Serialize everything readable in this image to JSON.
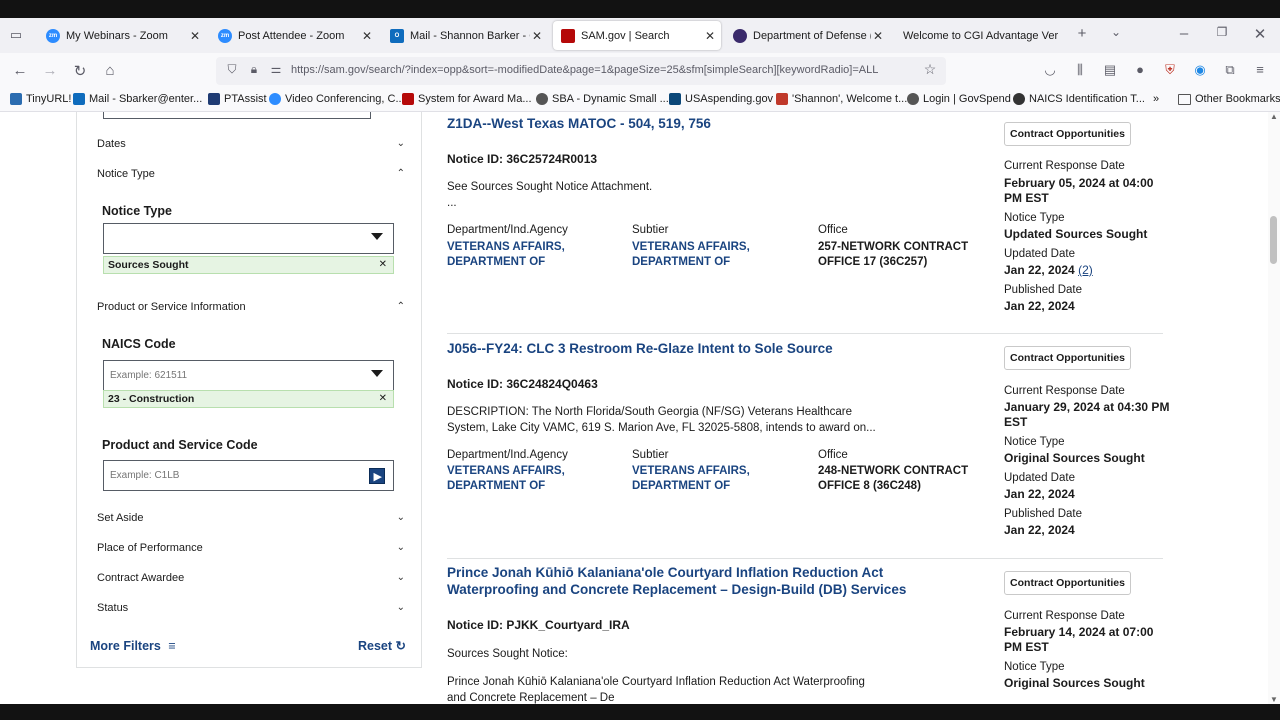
{
  "browser": {
    "tabs": [
      {
        "label": "My Webinars - Zoom",
        "icon": "zoom-icon",
        "color": "#2d8cff"
      },
      {
        "label": "Post Attendee - Zoom",
        "icon": "zoom-icon",
        "color": "#2d8cff"
      },
      {
        "label": "Mail - Shannon Barker - Out",
        "icon": "outlook-icon",
        "color": "#0f6cbd"
      },
      {
        "label": "SAM.gov | Search",
        "icon": "sam-icon",
        "color": "#b50909"
      },
      {
        "label": "Department of Defense (Do",
        "icon": "dod-icon",
        "color": "#3a2a6b"
      },
      {
        "label": "Welcome to CGI Advantage Ver",
        "icon": "",
        "color": ""
      }
    ],
    "url": "https://sam.gov/search/?index=opp&sort=-modifiedDate&page=1&pageSize=25&sfm[simpleSearch][keywordRadio]=ALL",
    "bookmarks": [
      {
        "label": "TinyURL!",
        "color": "#2b6cb0"
      },
      {
        "label": "Mail - Sbarker@enter...",
        "color": "#0f6cbd"
      },
      {
        "label": "PTAssist",
        "color": "#1f3b73"
      },
      {
        "label": "Video Conferencing, C...",
        "color": "#2d8cff"
      },
      {
        "label": "System for Award Ma...",
        "color": "#b50909"
      },
      {
        "label": "SBA - Dynamic Small ...",
        "color": "#555555"
      },
      {
        "label": "USAspending.gov",
        "color": "#0b4778"
      },
      {
        "label": "'Shannon', Welcome t...",
        "color": "#c0392b"
      },
      {
        "label": "Login | GovSpend",
        "color": "#555555"
      },
      {
        "label": "NAICS Identification T...",
        "color": "#333333"
      }
    ],
    "other_bookmarks": "Other Bookmarks"
  },
  "filters": {
    "dates": "Dates",
    "notice_type_section": "Notice Type",
    "notice_type_label": "Notice Type",
    "notice_type_chip": "Sources Sought",
    "product_section": "Product or Service Information",
    "naics_label": "NAICS Code",
    "naics_placeholder": "Example: 621511",
    "naics_chip": "23 - Construction",
    "psc_label": "Product and Service Code",
    "psc_placeholder": "Example: C1LB",
    "set_aside": "Set Aside",
    "place_of_performance": "Place of Performance",
    "contract_awardee": "Contract Awardee",
    "status": "Status",
    "more_filters": "More Filters",
    "reset": "Reset"
  },
  "labels": {
    "dept": "Department/Ind.Agency",
    "subtier": "Subtier",
    "office": "Office",
    "response_date": "Current Response Date",
    "notice_type": "Notice Type",
    "updated_date": "Updated Date",
    "published_date": "Published Date",
    "contract_button": "Contract Opportunities"
  },
  "results": [
    {
      "title": "Z1DA--West Texas MATOC - 504, 519, 756",
      "notice_id": "Notice ID: 36C25724R0013",
      "description": "See Sources Sought Notice Attachment.",
      "description2": "...",
      "dept": "VETERANS AFFAIRS, DEPARTMENT OF",
      "subtier": "VETERANS AFFAIRS, DEPARTMENT OF",
      "office": "257-NETWORK CONTRACT OFFICE 17 (36C257)",
      "response_date": "February 05, 2024 at 04:00 PM EST",
      "notice_type": "Updated Sources Sought",
      "updated_date": "Jan 22, 2024",
      "updated_count": "(2)",
      "published_date": "Jan 22, 2024"
    },
    {
      "title": "J056--FY24: CLC 3 Restroom Re-Glaze Intent to Sole Source",
      "notice_id": "Notice ID: 36C24824Q0463",
      "description": "DESCRIPTION: The North Florida/South Georgia (NF/SG) Veterans Healthcare System, Lake City VAMC, 619 S. Marion Ave, FL 32025-5808, intends to award on...",
      "dept": "VETERANS AFFAIRS, DEPARTMENT OF",
      "subtier": "VETERANS AFFAIRS, DEPARTMENT OF",
      "office": "248-NETWORK CONTRACT OFFICE 8 (36C248)",
      "response_date": "January 29, 2024 at 04:30 PM EST",
      "notice_type": "Original Sources Sought",
      "updated_date": "Jan 22, 2024",
      "published_date": "Jan 22, 2024"
    },
    {
      "title": "Prince Jonah Kūhiō Kalaniana'ole Courtyard Inflation Reduction Act Waterproofing and Concrete Replacement – Design-Build (DB) Services",
      "notice_id": "Notice ID: PJKK_Courtyard_IRA",
      "description": "Sources Sought Notice:",
      "description2": "Prince Jonah Kūhiō Kalaniana'ole Courtyard Inflation Reduction Act Waterproofing and Concrete Replacement – De",
      "response_date": "February 14, 2024 at 07:00 PM EST",
      "notice_type": "Original Sources Sought"
    }
  ]
}
